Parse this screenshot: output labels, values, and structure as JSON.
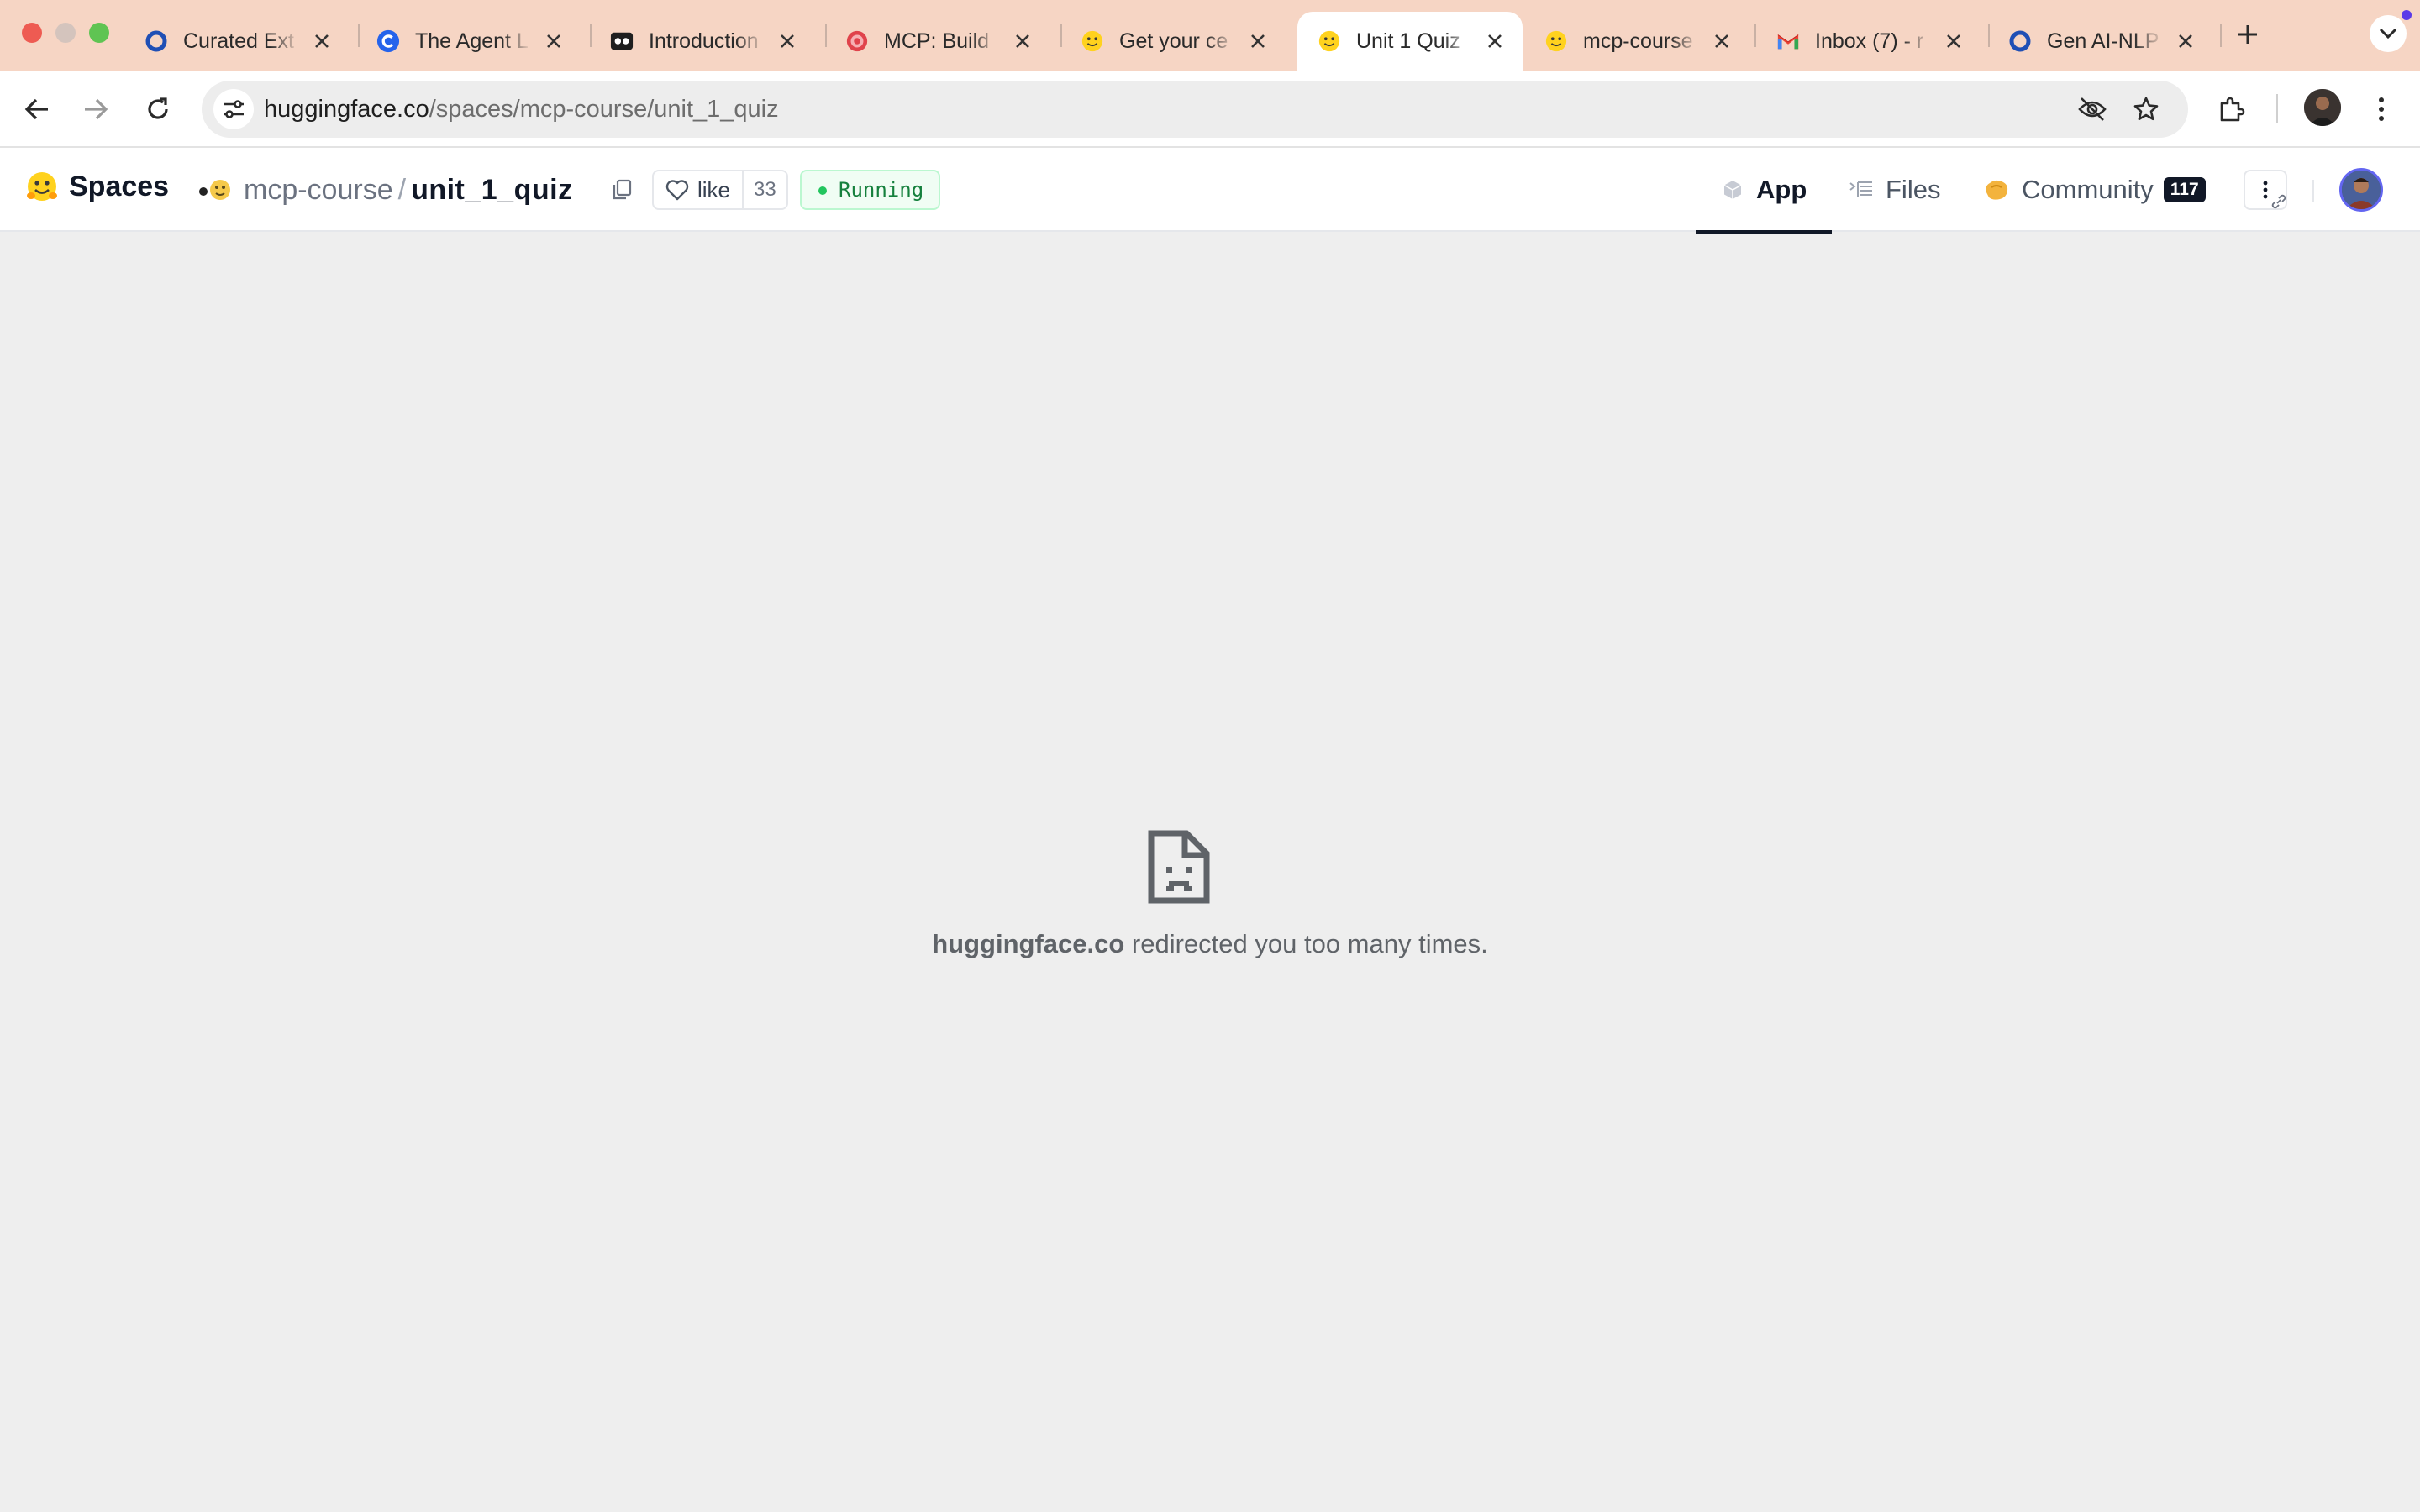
{
  "tabs": [
    {
      "title": "Curated Ext",
      "favicon": "circle-o-icon",
      "active": false
    },
    {
      "title": "The Agent L",
      "favicon": "c-logo-icon",
      "active": false
    },
    {
      "title": "Introduction",
      "favicon": "robot-icon",
      "active": false
    },
    {
      "title": "MCP: Build",
      "favicon": "target-logo-icon",
      "active": false
    },
    {
      "title": "Get your ce",
      "favicon": "hf-emoji-icon",
      "active": false
    },
    {
      "title": "Unit 1 Quiz",
      "favicon": "hf-emoji-icon",
      "active": true
    },
    {
      "title": "mcp-course",
      "favicon": "hf-emoji-icon",
      "active": false
    },
    {
      "title": "Inbox (7) - r",
      "favicon": "gmail-icon",
      "active": false
    },
    {
      "title": "Gen AI-NLP",
      "favicon": "circle-o-icon",
      "active": false
    }
  ],
  "address_bar": {
    "host": "huggingface.co",
    "path": "/spaces/mcp-course/unit_1_quiz"
  },
  "colors": {
    "tab_strip": "#f6d5c4",
    "running_green": "#15803d",
    "content_bg": "#eeeeee"
  },
  "hf": {
    "brand": "Spaces",
    "owner": "mcp-course",
    "separator": "/",
    "repo": "unit_1_quiz",
    "like_label": "like",
    "like_count": "33",
    "status": "Running",
    "nav": [
      {
        "label": "App",
        "icon": "cube-icon",
        "active": true
      },
      {
        "label": "Files",
        "icon": "files-icon",
        "active": false
      },
      {
        "label": "Community",
        "icon": "community-icon",
        "active": false,
        "count": "117"
      }
    ]
  },
  "error": {
    "host": "huggingface.co",
    "message": " redirected you too many times."
  }
}
